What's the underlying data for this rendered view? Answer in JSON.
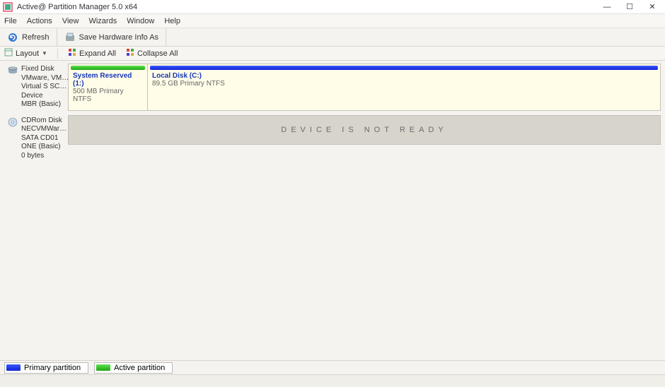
{
  "window": {
    "title": "Active@ Partition Manager 5.0 x64"
  },
  "menu": {
    "file": "File",
    "actions": "Actions",
    "view": "View",
    "wizards": "Wizards",
    "window": "Window",
    "help": "Help"
  },
  "toolbar": {
    "refresh": "Refresh",
    "save_hw": "Save Hardware Info As"
  },
  "subtoolbar": {
    "layout": "Layout",
    "expand": "Expand All",
    "collapse": "Collapse All"
  },
  "disks": [
    {
      "lines": [
        "Fixed Disk",
        "VMware, VMware",
        "Virtual S SCSI Disk",
        "Device",
        "MBR (Basic)"
      ],
      "icon": "hdd",
      "partitions": [
        {
          "name": "System Reserved (1:)",
          "sub": "500 MB Primary NTFS",
          "color": "green",
          "width": 112
        },
        {
          "name": "Local Disk (C:)",
          "sub": "89.5 GB Primary NTFS",
          "color": "blue",
          "width": 0
        }
      ]
    },
    {
      "lines": [
        "CDRom Disk",
        "NECVMWarVMware",
        "SATA CD01",
        "ONE (Basic)",
        "0 bytes"
      ],
      "icon": "cd",
      "notready": "DEVICE IS NOT READY"
    }
  ],
  "legend": {
    "primary": "Primary partition",
    "active": "Active partition"
  }
}
